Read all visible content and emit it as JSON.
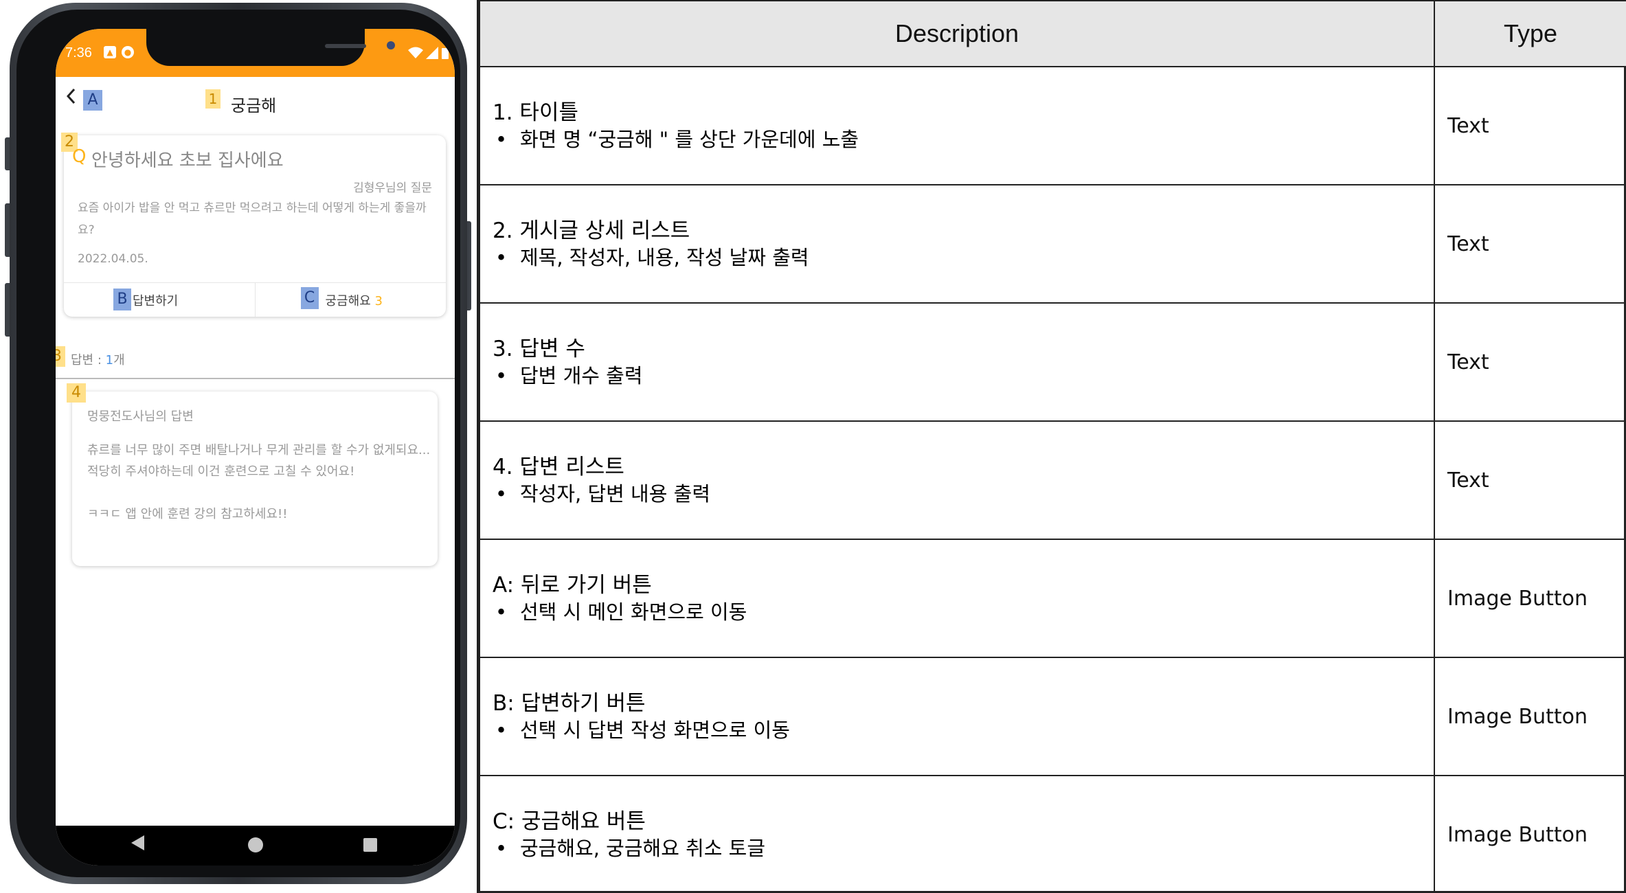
{
  "phone": {
    "status_time": "7:36",
    "title": "궁금해",
    "back_tag": "A",
    "markers": {
      "m1": "1",
      "m2": "2",
      "m3": "3",
      "m4": "4"
    },
    "question": {
      "q_mark": "Q",
      "title": "안녕하세요 초보 집사에요",
      "author": "김형우님의 질문",
      "body": "요즘 아이가 밥을 안 먹고 츄르만 먹으려고 하는데 어떻게 하는게 좋을까요?",
      "date": "2022.04.05."
    },
    "actions": {
      "answer_tag": "B",
      "answer_label": "답변하기",
      "curious_tag": "C",
      "curious_label": "궁금해요",
      "curious_count": "3"
    },
    "answers_count": {
      "prefix": "답변 : ",
      "count": "1",
      "suffix": "개"
    },
    "answer": {
      "author": "멍뭉전도사님의 답변",
      "body": "츄르를 너무 많이 주면 배탈나거나 무게 관리를 할 수가 없게되요... 적당히 주셔야하는데 이건 훈련으로 고칠 수 있어요!\n\nㅋㅋㄷ 앱 안에 훈련 강의 참고하세요!!"
    },
    "colors": {
      "accent": "#fd9a12",
      "tag_blue": "#87a7e0",
      "tag_yellow": "#ffe08a"
    }
  },
  "table": {
    "headers": {
      "description": "Description",
      "type": "Type"
    },
    "rows": [
      {
        "title": "1.  타이틀",
        "bullet": "화면 명 “궁금해 \" 를 상단 가운데에 노출",
        "type": "Text"
      },
      {
        "title": "2.  게시글 상세 리스트",
        "bullet": "제목, 작성자, 내용, 작성 날짜 출력",
        "type": "Text"
      },
      {
        "title": "3.  답변 수",
        "bullet": "답변 개수 출력",
        "type": "Text"
      },
      {
        "title": "4.  답변 리스트",
        "bullet": "작성자, 답변 내용 출력",
        "type": "Text"
      },
      {
        "title": "A: 뒤로 가기 버튼",
        "bullet": "선택 시 메인 화면으로 이동",
        "type": "Image Button"
      },
      {
        "title": "B: 답변하기 버튼",
        "bullet": "선택 시 답변 작성 화면으로 이동",
        "type": "Image Button"
      },
      {
        "title": "C: 궁금해요 버튼",
        "bullet": "궁금해요, 궁금해요 취소 토글",
        "type": "Image Button"
      }
    ],
    "bullet_char": "•"
  }
}
